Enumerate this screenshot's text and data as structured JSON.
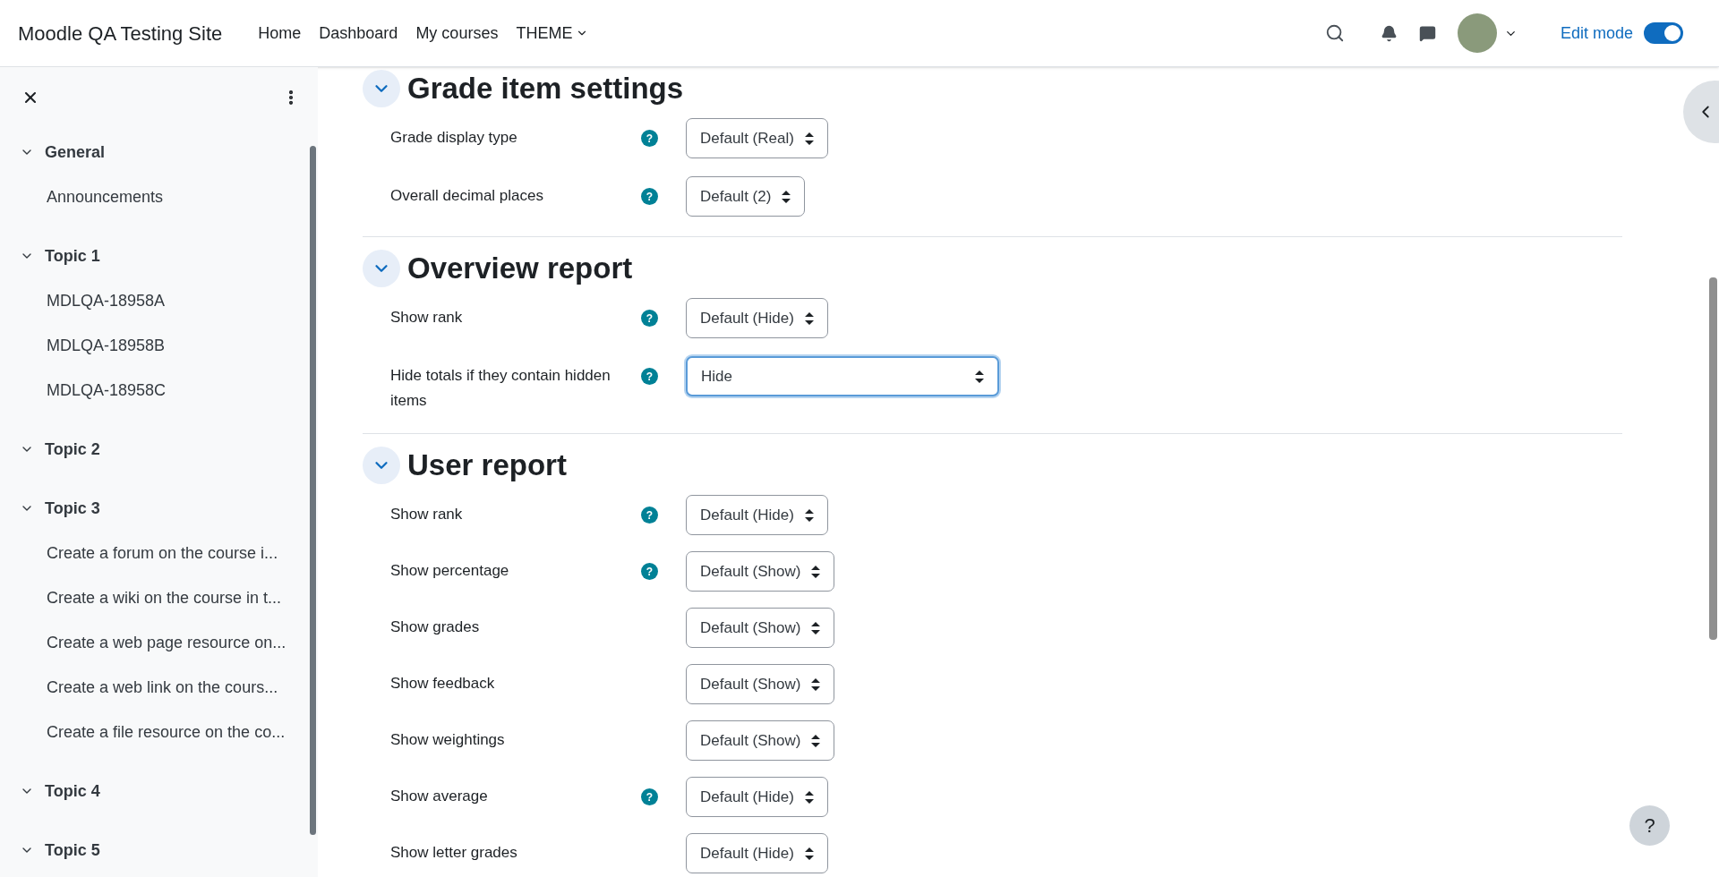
{
  "header": {
    "site_name": "Moodle QA Testing Site",
    "nav": [
      {
        "label": "Home",
        "dropdown": false
      },
      {
        "label": "Dashboard",
        "dropdown": false
      },
      {
        "label": "My courses",
        "dropdown": false
      },
      {
        "label": "THEME",
        "dropdown": true
      }
    ],
    "edit_mode": {
      "label": "Edit mode",
      "on": true
    }
  },
  "sidebar": {
    "sections": [
      {
        "title": "General",
        "expanded": true,
        "items": [
          "Announcements"
        ]
      },
      {
        "title": "Topic 1",
        "expanded": true,
        "items": [
          "MDLQA-18958A",
          "MDLQA-18958B",
          "MDLQA-18958C"
        ]
      },
      {
        "title": "Topic 2",
        "expanded": true
      },
      {
        "title": "Topic 3",
        "expanded": true,
        "items": [
          "Create a forum on the course i...",
          "Create a wiki on the course in t...",
          "Create a web page resource on...",
          "Create a web link on the cours...",
          "Create a file resource on the co..."
        ]
      },
      {
        "title": "Topic 4",
        "expanded": true
      },
      {
        "title": "Topic 5",
        "expanded": true
      }
    ]
  },
  "sections": [
    {
      "title": "Grade item settings",
      "expanded": true,
      "rows": [
        {
          "label": "Grade display type",
          "help": "?",
          "value": "Default (Real)",
          "focused": false
        },
        {
          "label": "Overall decimal places",
          "help": "?",
          "value": "Default (2)",
          "focused": false
        }
      ]
    },
    {
      "title": "Overview report",
      "expanded": true,
      "rows": [
        {
          "label": "Show rank",
          "help": "?",
          "value": "Default (Hide)",
          "focused": false
        },
        {
          "label": "Hide totals if they contain hidden items",
          "help": "?",
          "value": "Hide",
          "focused": true
        }
      ]
    },
    {
      "title": "User report",
      "expanded": true,
      "rows": [
        {
          "label": "Show rank",
          "help": "?",
          "value": "Default (Hide)",
          "focused": false
        },
        {
          "label": "Show percentage",
          "help": "?",
          "value": "Default (Show)",
          "focused": false
        },
        {
          "label": "Show grades",
          "value": "Default (Show)",
          "focused": false
        },
        {
          "label": "Show feedback",
          "value": "Default (Show)",
          "focused": false
        },
        {
          "label": "Show weightings",
          "value": "Default (Show)",
          "focused": false
        },
        {
          "label": "Show average",
          "help": "?",
          "value": "Default (Hide)",
          "focused": false
        },
        {
          "label": "Show letter grades",
          "value": "Default (Hide)",
          "focused": false
        }
      ]
    }
  ],
  "help_button": {
    "label": "?"
  }
}
